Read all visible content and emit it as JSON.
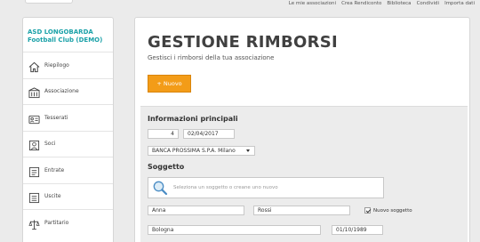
{
  "topnav": {
    "links": [
      "Le mie associazioni",
      "Crea Rendiconto",
      "Biblioteca",
      "Condividi",
      "Importa dati"
    ]
  },
  "sidebar": {
    "club_name": "ASD LONGOBARDA Football Club (DEMO)",
    "items": [
      {
        "label": "Riepilogo",
        "icon": "home-icon"
      },
      {
        "label": "Associazione",
        "icon": "association-icon"
      },
      {
        "label": "Tesserati",
        "icon": "members-card-icon"
      },
      {
        "label": "Soci",
        "icon": "user-icon"
      },
      {
        "label": "Entrate",
        "icon": "income-icon"
      },
      {
        "label": "Uscite",
        "icon": "expense-icon"
      },
      {
        "label": "Partitario",
        "icon": "scales-icon"
      }
    ]
  },
  "main": {
    "title": "GESTIONE RIMBORSI",
    "subtitle": "Gestisci i rimborsi della tua associazione",
    "new_button": "+ Nuovo",
    "info_section": {
      "title": "Informazioni principali",
      "number": "4",
      "date": "02/04/2017",
      "bank_select": "BANCA PROSSIMA S.P.A. Milano"
    },
    "subject_section": {
      "title": "Soggetto",
      "search_placeholder": "Seleziona un soggetto o creane uno nuovo",
      "first_name": "Anna",
      "last_name": "Rossi",
      "new_subject_label": "Nuovo soggetto",
      "new_subject_checked": true,
      "city": "Bologna",
      "birth_date": "01/10/1989"
    }
  },
  "colors": {
    "accent_teal": "#1aa1a8",
    "button_orange": "#f39c18",
    "panel_gray": "#ececec"
  }
}
